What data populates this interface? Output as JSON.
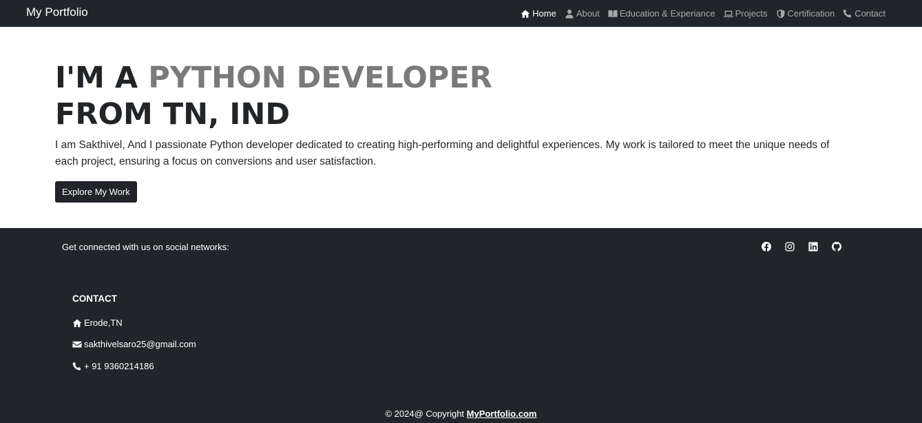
{
  "navbar": {
    "brand": "My Portfolio",
    "items": [
      {
        "label": "Home",
        "icon": "home-icon",
        "active": true
      },
      {
        "label": "About",
        "icon": "user-icon",
        "active": false
      },
      {
        "label": "Education & Experiance",
        "icon": "book-icon",
        "active": false
      },
      {
        "label": "Projects",
        "icon": "laptop-icon",
        "active": false
      },
      {
        "label": "Certification",
        "icon": "shield-icon",
        "active": false
      },
      {
        "label": "Contact",
        "icon": "phone-icon",
        "active": false
      }
    ]
  },
  "hero": {
    "line1_prefix": "I'M A ",
    "line1_accent": "PYTHON DEVELOPER",
    "line2": "FROM TN, IND",
    "intro": "I am Sakthivel, And I passionate Python developer dedicated to creating high-performing and delightful experiences. My work is tailored to meet the unique needs of each project, ensuring a focus on conversions and user satisfaction.",
    "cta_label": "Explore My Work"
  },
  "footer": {
    "social_text": "Get connected with us on social networks:",
    "social_icons": [
      "facebook-icon",
      "instagram-icon",
      "linkedin-icon",
      "github-icon"
    ],
    "contact": {
      "title": "CONTACT",
      "location": "Erode,TN",
      "email": "sakthivelsaro25@gmail.com",
      "phone": "+ 91 9360214186"
    },
    "copyright_prefix": "© 2024@ Copyright ",
    "copyright_link": "MyPortfolio.com"
  },
  "colors": {
    "dark": "#212529",
    "accent_gray": "#7a7a7a",
    "white": "#ffffff"
  }
}
